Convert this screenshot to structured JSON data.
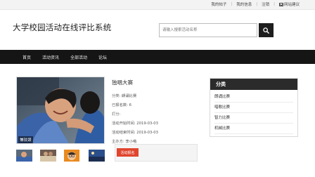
{
  "topbar": {
    "links": [
      "我的帖子",
      "我的信息",
      "注销"
    ],
    "feedback_label": "网站建议"
  },
  "header": {
    "site_title": "大学校园活动在线评比系统",
    "search_placeholder": "请输入搜索活动名称"
  },
  "nav": {
    "items": [
      "首页",
      "活动资讯",
      "全部活动",
      "论坛"
    ]
  },
  "activity": {
    "title": "独唱大赛",
    "photo_caption": "兼玟颈",
    "category": "分类: 朗诵比赛",
    "signup_count": "已报名数: 6",
    "rating": "打分:",
    "start_time": "活动开始时间: 2019-03-03",
    "end_time": "活动结束时间: 2019-03-03",
    "host": "主办方: 李小哦",
    "signup_button": "活动报名"
  },
  "sidebar": {
    "header": "分类",
    "items": [
      "朗诵比赛",
      "唱歌比赛",
      "智力比赛",
      "机械比赛"
    ]
  },
  "colors": {
    "nav_bg": "#151515",
    "accent_red": "#e0452e",
    "panel_header": "#2b2b2b"
  }
}
